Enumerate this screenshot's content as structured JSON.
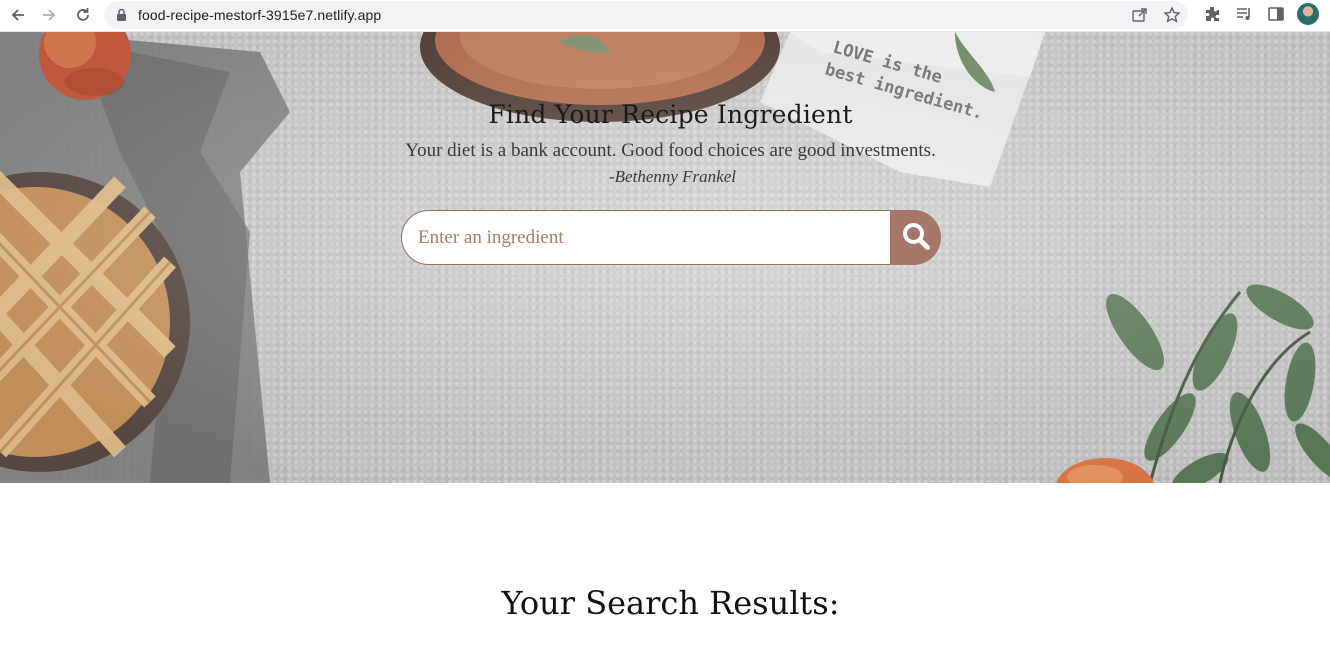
{
  "browser": {
    "url": "food-recipe-mestorf-3915e7.netlify.app",
    "icons": [
      "back-icon",
      "forward-icon",
      "reload-icon",
      "lock-icon",
      "share-icon",
      "star-icon",
      "extensions-icon",
      "media-icon",
      "side-panel-icon",
      "avatar"
    ]
  },
  "hero": {
    "title": "Find Your Recipe Ingredient",
    "quote": "Your diet is a bank account. Good food choices are good investments.",
    "author": "-Bethenny Frankel",
    "napkin_text": [
      "LOVE is the",
      "best ingredient."
    ]
  },
  "search": {
    "placeholder": "Enter an ingredient",
    "value": "",
    "button_icon": "search-icon"
  },
  "results": {
    "title": "Your Search Results:"
  },
  "colors": {
    "accent": "#a4776a",
    "input_border": "#9a6f5d",
    "placeholder": "#a77d69",
    "background": "#c9c9c9"
  }
}
